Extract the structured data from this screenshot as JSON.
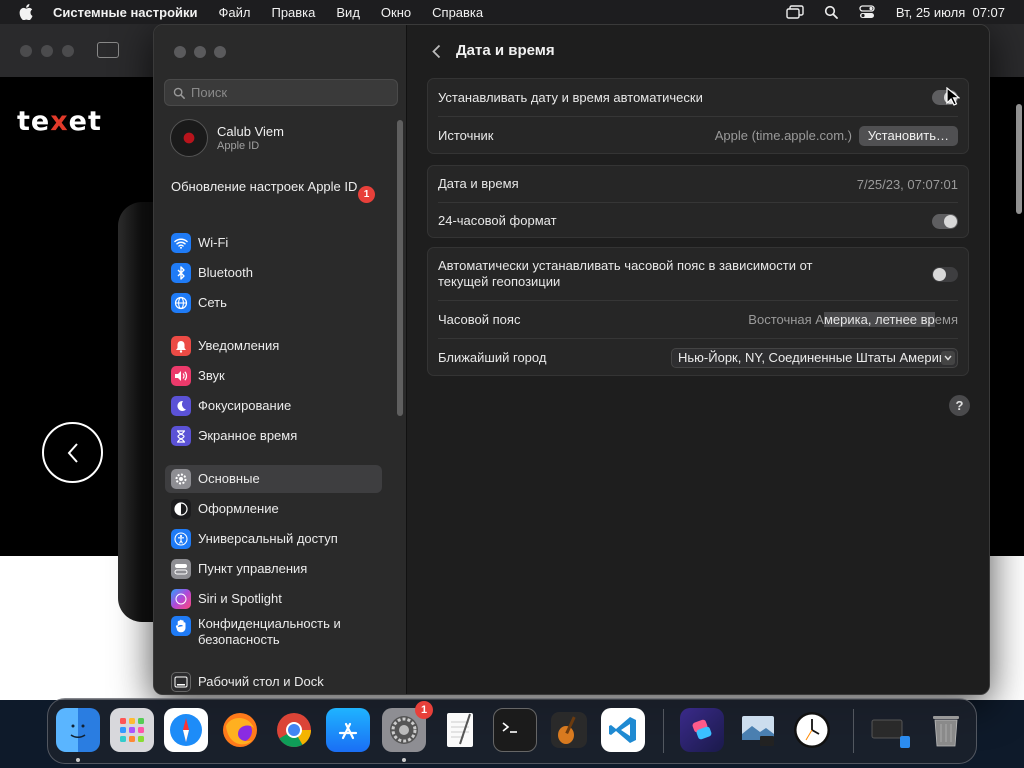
{
  "menubar": {
    "app_name": "Системные настройки",
    "items": [
      "Файл",
      "Правка",
      "Вид",
      "Окно",
      "Справка"
    ],
    "clock": "Вт, 25 июля  07:07"
  },
  "browser": {
    "logo": [
      "te",
      "x",
      "et"
    ]
  },
  "sidebar": {
    "search_placeholder": "Поиск",
    "account": {
      "name": "Calub Viem",
      "subtitle": "Apple ID"
    },
    "update": {
      "label": "Обновление настроек Apple ID",
      "badge": "1"
    },
    "items": [
      {
        "label": "Wi-Fi",
        "icon": "wifi-icon",
        "color": "#1f7bf6"
      },
      {
        "label": "Bluetooth",
        "icon": "bluetooth-icon",
        "color": "#1f7bf6"
      },
      {
        "label": "Сеть",
        "icon": "globe-icon",
        "color": "#1f7bf6"
      },
      {
        "label": "Уведомления",
        "icon": "bell-icon",
        "color": "#ec4b45"
      },
      {
        "label": "Звук",
        "icon": "speaker-icon",
        "color": "#ec3a6b"
      },
      {
        "label": "Фокусирование",
        "icon": "moon-icon",
        "color": "#5b52d6"
      },
      {
        "label": "Экранное время",
        "icon": "hourglass-icon",
        "color": "#5b52d6"
      },
      {
        "label": "Основные",
        "icon": "gear-icon",
        "color": "#8e8e93"
      },
      {
        "label": "Оформление",
        "icon": "appearance-icon",
        "color": "#1c1c1e"
      },
      {
        "label": "Универсальный доступ",
        "icon": "accessibility-icon",
        "color": "#1f7bf6"
      },
      {
        "label": "Пункт управления",
        "icon": "control-center-icon",
        "color": "#8e8e93"
      },
      {
        "label": "Siri и Spotlight",
        "icon": "siri-icon",
        "color": "#b048d8"
      },
      {
        "label": "Конфиденциальность и безопасность",
        "icon": "hand-icon",
        "color": "#1f7bf6"
      },
      {
        "label": "Рабочий стол и Dock",
        "icon": "dock-icon",
        "color": "#2c2c2e"
      }
    ],
    "active_item": "Основные"
  },
  "main": {
    "title": "Дата и время",
    "auto_datetime": {
      "label": "Устанавливать дату и время автоматически",
      "enabled": true
    },
    "source": {
      "label": "Источник",
      "value": "Apple (time.apple.com.)",
      "button": "Установить…"
    },
    "datetime": {
      "label": "Дата и время",
      "value": "7/25/23, 07:07:01"
    },
    "format24": {
      "label": "24-часовой формат",
      "enabled": true
    },
    "auto_timezone": {
      "label": "Автоматически устанавливать часовой пояс в зависимости от текущей геопозиции",
      "enabled": false
    },
    "timezone": {
      "label": "Часовой пояс",
      "value_parts": [
        "Восточная А",
        "мерика, летнее вр",
        "емя"
      ]
    },
    "city": {
      "label": "Ближайший город",
      "value": "Нью-Йорк, NY, Соединенные Штаты Америки"
    },
    "help": "?"
  },
  "dock": {
    "apps": [
      "finder",
      "launchpad",
      "safari",
      "firefox",
      "chrome",
      "app-store",
      "system-settings",
      "textedit",
      "terminal",
      "garageband",
      "vscode",
      "shortcuts",
      "preview",
      "clock",
      "screen-capture",
      "trash"
    ],
    "settings_badge": "1"
  }
}
